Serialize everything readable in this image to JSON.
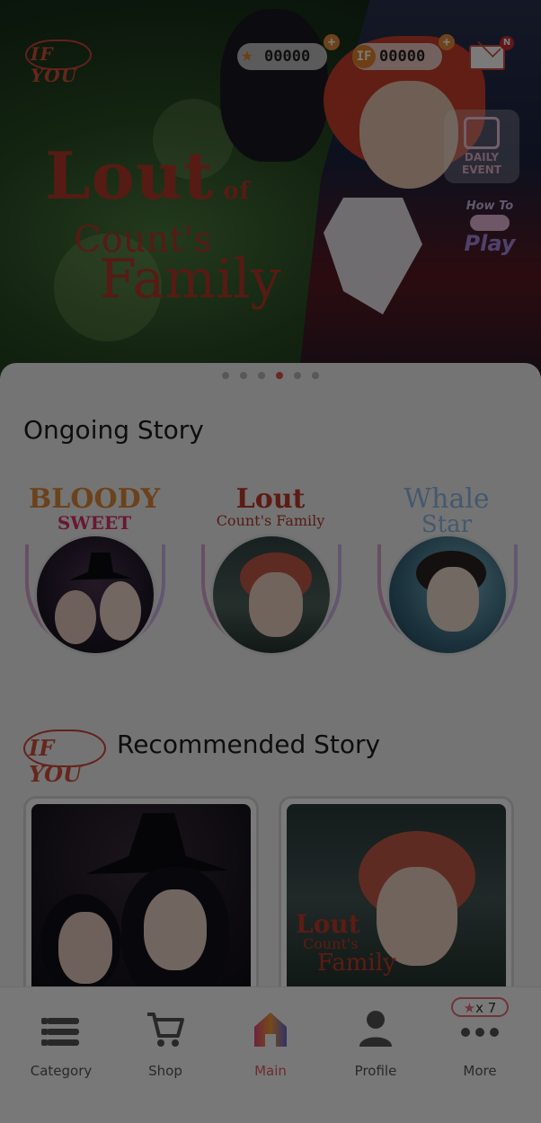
{
  "header": {
    "logo_text": "IF YOU",
    "star_count": "00000",
    "coin_count": "00000",
    "coin_symbol": "IF",
    "mail_badge": "N"
  },
  "banner": {
    "title_line1": "Lout",
    "title_of": "of",
    "title_line2": "Count's",
    "title_line3": "Family",
    "daily_event_line1": "DAILY",
    "daily_event_line2": "EVENT",
    "how_to": "How To",
    "play": "Play",
    "active_page": 4,
    "page_count": 6
  },
  "ongoing": {
    "section_title": "Ongoing Story",
    "stories": [
      {
        "title_top": "BLOODY",
        "title_bottom": "SWEET"
      },
      {
        "title_top": "Lout",
        "title_bottom": "Count's Family"
      },
      {
        "title_top": "Whale",
        "title_bottom": "Star"
      }
    ]
  },
  "recommended": {
    "logo_text": "IF YOU",
    "section_title": "Recommended Story",
    "cards": [
      {
        "title": ""
      },
      {
        "title_a": "Lout",
        "title_b": "Count's",
        "title_c": "Family"
      }
    ]
  },
  "nav": {
    "items": [
      {
        "label": "Category",
        "icon": "list-icon"
      },
      {
        "label": "Shop",
        "icon": "cart-icon"
      },
      {
        "label": "Main",
        "icon": "home-icon",
        "active": true
      },
      {
        "label": "Profile",
        "icon": "person-icon"
      },
      {
        "label": "More",
        "icon": "more-icon"
      }
    ],
    "more_badge": "x 7"
  },
  "colors": {
    "accent": "#e35a6a",
    "brand_red": "#d4503b",
    "overlay": "#00000085"
  }
}
